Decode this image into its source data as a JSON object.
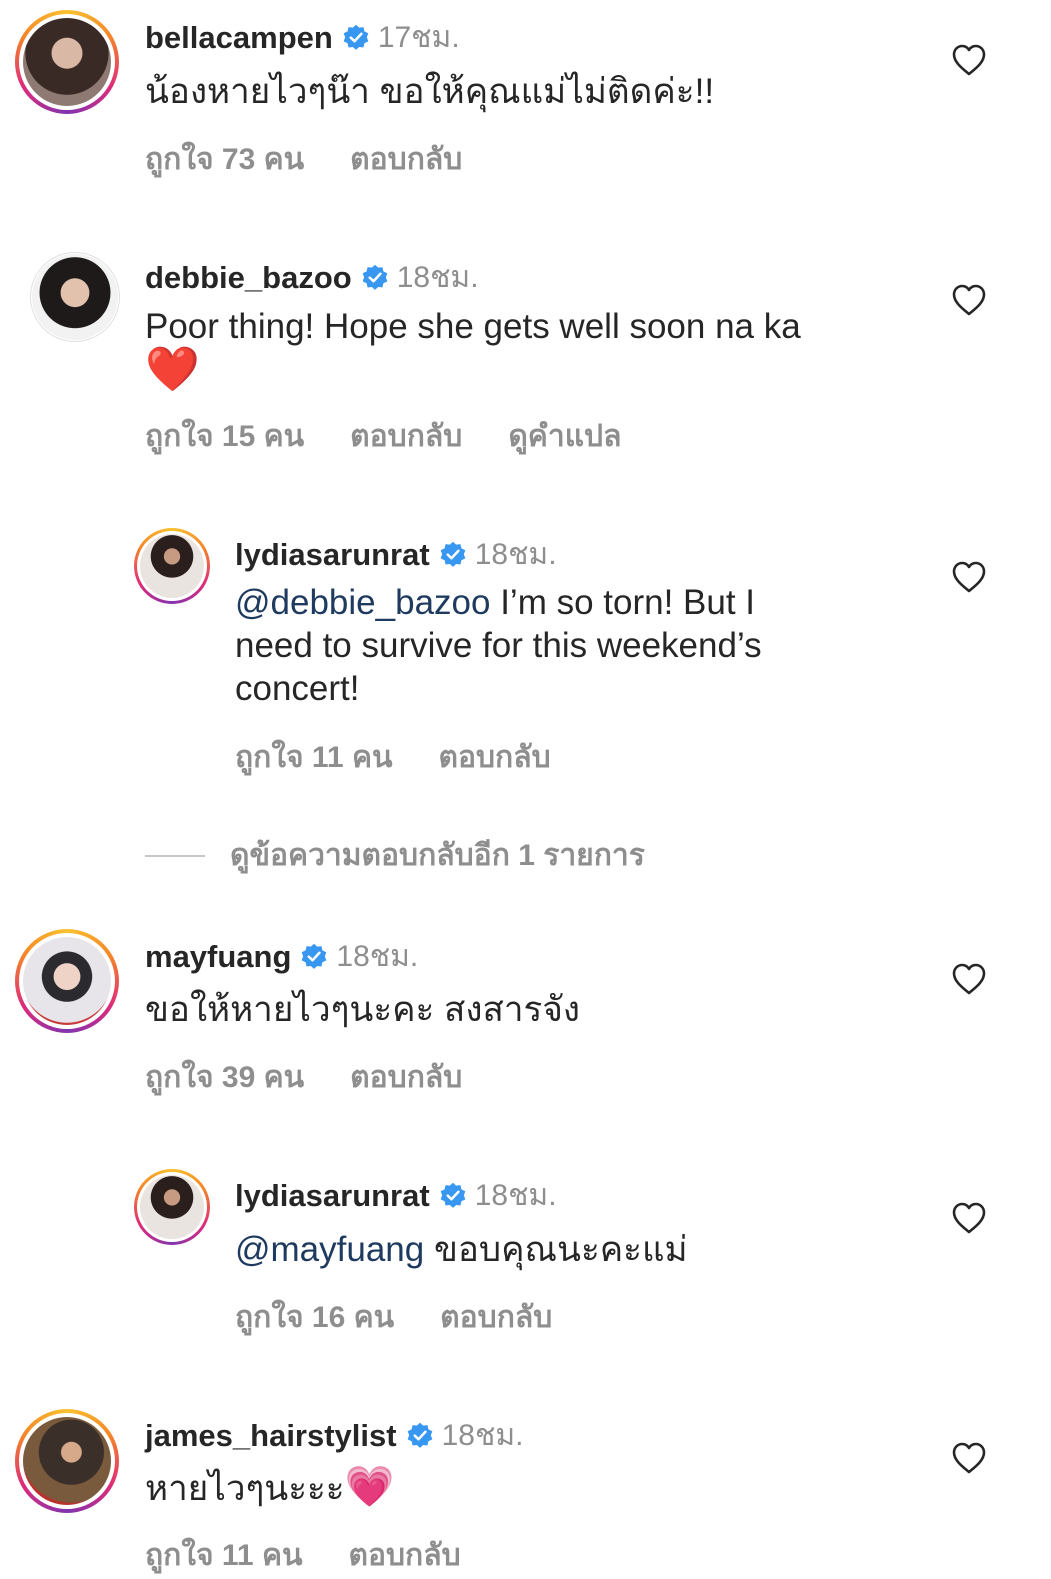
{
  "comments": [
    {
      "username": "bellacampen",
      "time": "17ชม.",
      "text": "น้องหายไวๆน๊า ขอให้คุณแม่ไม่ติดค่ะ!!",
      "likes": "ถูกใจ 73 คน",
      "reply": "ตอบกลับ"
    },
    {
      "username": "debbie_bazoo",
      "time": "18ชม.",
      "text": "Poor thing! Hope she gets well soon na ka",
      "emoji": "❤️",
      "likes": "ถูกใจ 15 คน",
      "reply": "ตอบกลับ",
      "translate": "ดูคำแปล"
    },
    {
      "username": "lydiasarunrat",
      "time": "18ชม.",
      "mention": "@debbie_bazoo",
      "text_line1": " I’m so torn! But I",
      "text_line2": "need to survive for this weekend’s",
      "text_line3": "concert!",
      "likes": "ถูกใจ 11 คน",
      "reply": "ตอบกลับ"
    },
    {
      "username": "mayfuang",
      "time": "18ชม.",
      "text": "ขอให้หายไวๆนะคะ สงสารจัง",
      "likes": "ถูกใจ 39 คน",
      "reply": "ตอบกลับ"
    },
    {
      "username": "lydiasarunrat",
      "time": "18ชม.",
      "mention": "@mayfuang",
      "text": " ขอบคุณนะคะแม่",
      "likes": "ถูกใจ 16 คน",
      "reply": "ตอบกลับ"
    },
    {
      "username": "james_hairstylist",
      "time": "18ชม.",
      "text": "หายไวๆนะะะ",
      "emoji": "💗",
      "likes": "ถูกใจ 11 คน",
      "reply": "ตอบกลับ"
    }
  ],
  "view_more_replies": "ดูข้อความตอบกลับอีก 1 รายการ",
  "icons": {
    "verified": "verified-badge-icon",
    "like": "heart-outline-icon"
  },
  "colors": {
    "verified_blue": "#3897f0",
    "mention": "#1e3a5f",
    "muted": "#8e8e8e"
  }
}
